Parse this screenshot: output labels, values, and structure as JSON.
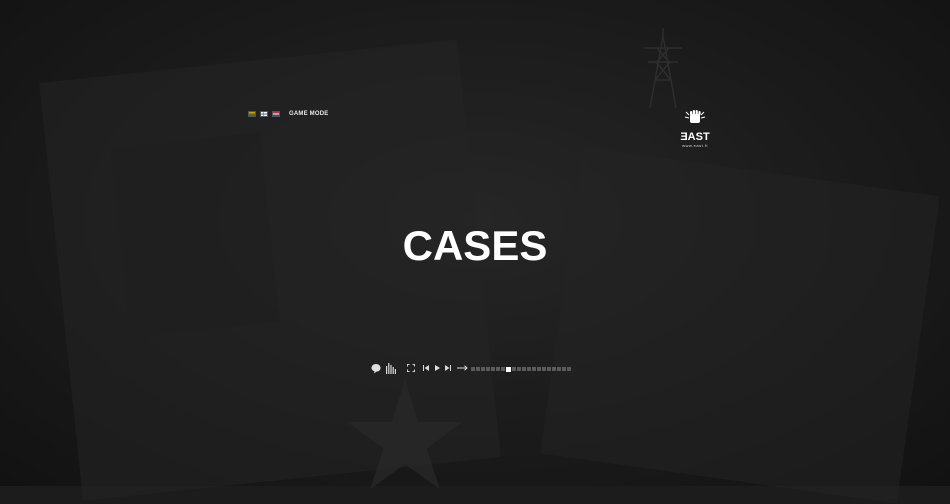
{
  "languages": [
    {
      "name": "lithuania-flag",
      "colors": [
        "#c9a400",
        "#2f7a3b",
        "#b23a2f"
      ]
    },
    {
      "name": "finland-flag",
      "colors": [
        "#ffffff",
        "#3a5ea8",
        "#ffffff"
      ]
    },
    {
      "name": "usa-flag",
      "colors": [
        "#b9353a",
        "#ffffff",
        "#3c4a86"
      ]
    }
  ],
  "header": {
    "game_mode_label": "GAME MODE"
  },
  "logo": {
    "text": "ƎAST",
    "url": "www.east.fi"
  },
  "page": {
    "title": "CASES"
  },
  "player": {
    "icons": [
      "chat-icon",
      "equalizer-icon",
      "fullscreen-icon",
      "previous-icon",
      "play-icon",
      "next-icon",
      "arrow-right-icon"
    ],
    "progress_segments": 20,
    "progress_active_index": 7
  },
  "colors": {
    "background": "#1c1c1c",
    "text": "#ffffff",
    "progress_inactive": "#5a5a5a",
    "progress_active": "#ffffff"
  }
}
